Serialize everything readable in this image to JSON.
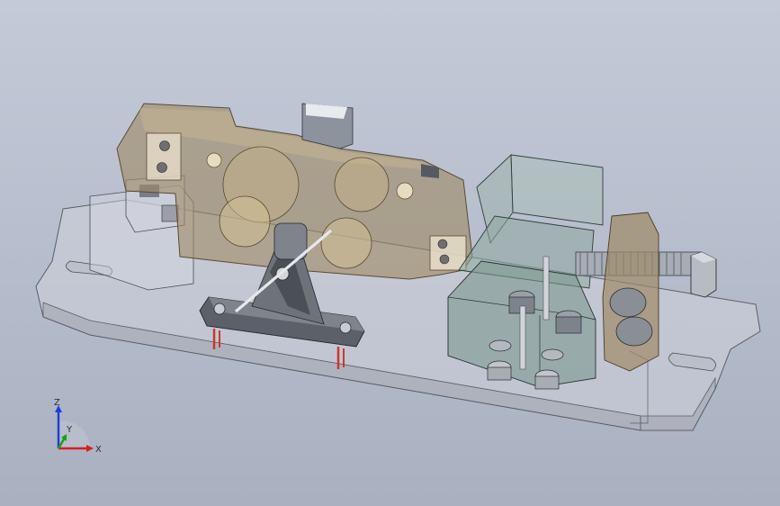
{
  "viewport": {
    "background_top": "#c4cad8",
    "background_bottom": "#a9b0c0"
  },
  "triad": {
    "x_label": "X",
    "y_label": "Y",
    "z_label": "Z",
    "x_color": "#d81e1e",
    "y_color": "#1aa01a",
    "z_color": "#1e3ed8"
  },
  "model": {
    "base_plate_color": "#c9ccd6",
    "load_cell_color": "#a08a66",
    "clamp_block_color": "#8fa8a0",
    "bolt_color": "#8a8f96",
    "pin_color": "#c83a2a"
  }
}
